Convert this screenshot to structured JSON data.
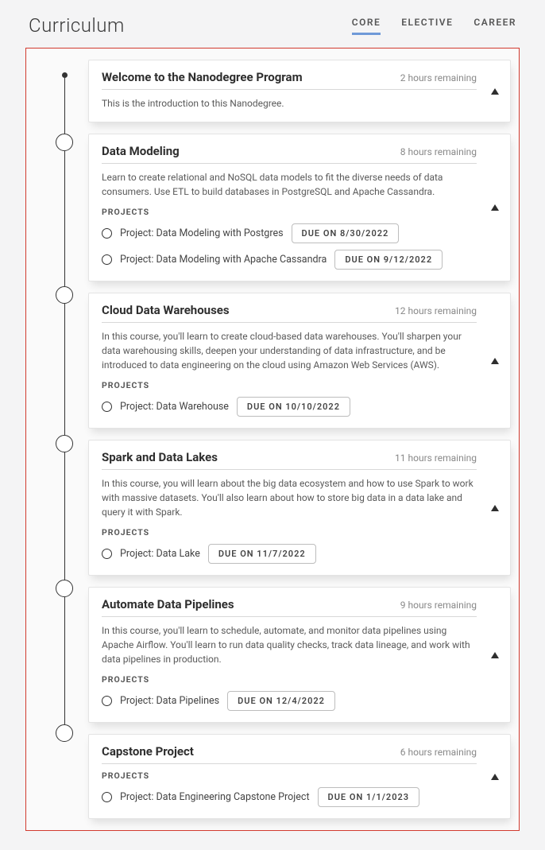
{
  "header": {
    "title": "Curriculum",
    "tabs": {
      "core": "CORE",
      "elective": "ELECTIVE",
      "career": "CAREER"
    }
  },
  "projects_label": "PROJECTS",
  "cards": [
    {
      "title": "Welcome to the Nanodegree Program",
      "meta": "2 hours remaining",
      "desc": "This is the introduction to this Nanodegree.",
      "projects": []
    },
    {
      "title": "Data Modeling",
      "meta": "8 hours remaining",
      "desc": "Learn to create relational and NoSQL data models to fit the diverse needs of data consumers. Use ETL to build databases in PostgreSQL and Apache Cassandra.",
      "projects": [
        {
          "name": "Project: Data Modeling with Postgres",
          "due": "DUE ON 8/30/2022"
        },
        {
          "name": "Project: Data Modeling with Apache Cassandra",
          "due": "DUE ON 9/12/2022"
        }
      ]
    },
    {
      "title": "Cloud Data Warehouses",
      "meta": "12 hours remaining",
      "desc": "In this course, you'll learn to create cloud-based data warehouses. You'll sharpen your data warehousing skills, deepen your understanding of data infrastructure, and be introduced to data engineering on the cloud using Amazon Web Services (AWS).",
      "projects": [
        {
          "name": "Project: Data Warehouse",
          "due": "DUE ON 10/10/2022"
        }
      ]
    },
    {
      "title": "Spark and Data Lakes",
      "meta": "11 hours remaining",
      "desc": "In this course, you will learn about the big data ecosystem and how to use Spark to work with massive datasets. You'll also learn about how to store big data in a data lake and query it with Spark.",
      "projects": [
        {
          "name": "Project: Data Lake",
          "due": "DUE ON 11/7/2022"
        }
      ]
    },
    {
      "title": "Automate Data Pipelines",
      "meta": "9 hours remaining",
      "desc": "In this course, you'll learn to schedule, automate, and monitor data pipelines using Apache Airflow. You'll learn to run data quality checks, track data lineage, and work with data pipelines in production.",
      "projects": [
        {
          "name": "Project: Data Pipelines",
          "due": "DUE ON 12/4/2022"
        }
      ]
    },
    {
      "title": "Capstone Project",
      "meta": "6 hours remaining",
      "desc": "",
      "projects": [
        {
          "name": "Project: Data Engineering Capstone Project",
          "due": "DUE ON 1/1/2023"
        }
      ]
    }
  ]
}
